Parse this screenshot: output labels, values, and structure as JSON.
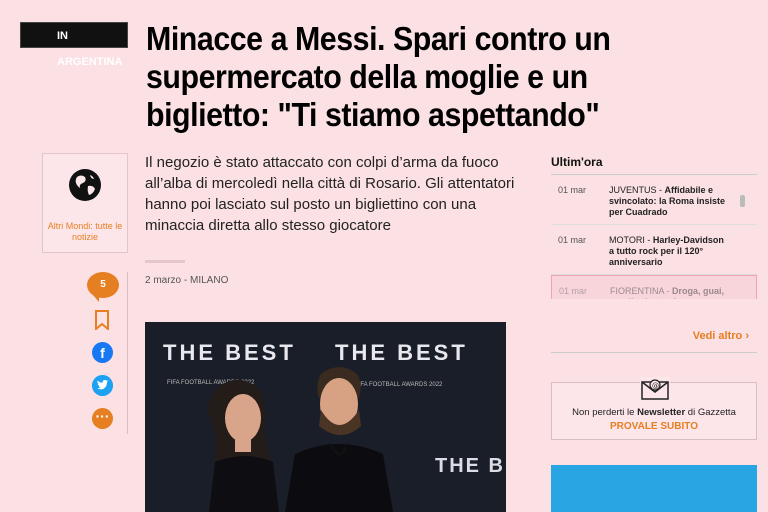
{
  "article": {
    "section_tag": "IN ARGENTINA",
    "title": "Minacce a Messi. Spari contro un supermercato della moglie e un biglietto: \"Ti stiamo aspettando\"",
    "summary": "Il negozio è stato attaccato con colpi d’arma da fuoco all’alba di mercoledì nella città di Rosario. Gli attentatori hanno poi lasciato sul posto un bigliettino con una minaccia diretta allo stesso giocatore",
    "meta": "2 marzo - MILANO",
    "photo_text": {
      "board_1": "THE BEST",
      "board_2": "THE BEST",
      "board_caption": "FIFA FOOTBALL AWARDS 2022"
    }
  },
  "side_card": {
    "icon": "globe-icon",
    "label": "Altri Mondi: tutte le notizie"
  },
  "share": {
    "comment_count": "5",
    "icons": [
      "comment-icon",
      "bookmark-icon",
      "facebook-icon",
      "twitter-icon",
      "more-icon"
    ]
  },
  "sidebar": {
    "title": "Ultim'ora",
    "items": [
      {
        "date": "01 mar",
        "prefix": "JUVENTUS - ",
        "headline": "Affidabile e svincolato: la Roma insiste per Cuadrado"
      },
      {
        "date": "01 mar",
        "prefix": "MOTORI - ",
        "headline": "Harley-Davidson a tutto rock per il 120° anniversario"
      },
      {
        "date": "01 mar",
        "prefix": "FIORENTINA - ",
        "headline": "Droga, guai, moeli rubate e la"
      }
    ],
    "more_label": "Vedi altro"
  },
  "newsletter": {
    "text_before": "Non perderti le ",
    "text_bold": "Newsletter",
    "text_after": " di Gazzetta",
    "cta": "PROVALE SUBITO"
  },
  "colors": {
    "background": "#fbe0e4",
    "accent": "#e67e22",
    "facebook": "#1877f2",
    "twitter": "#1da1f2"
  }
}
